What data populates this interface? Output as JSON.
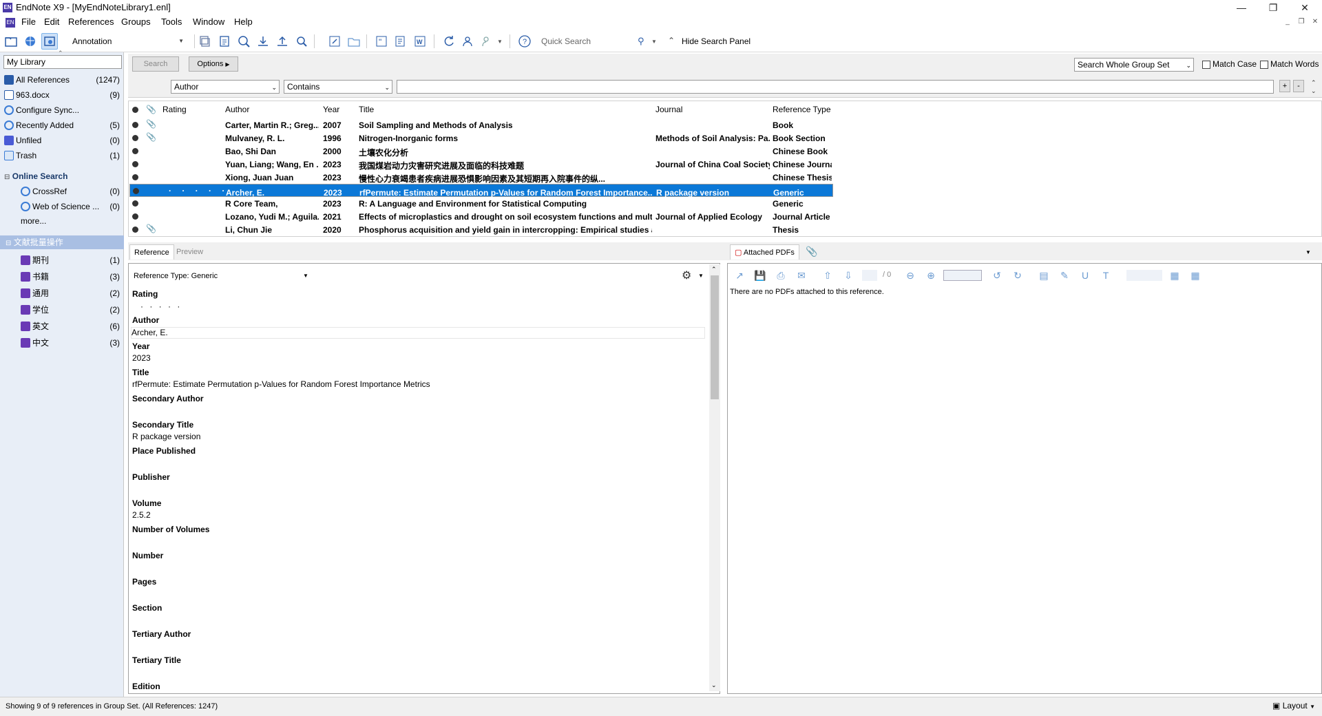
{
  "window": {
    "title": "EndNote X9 - [MyEndNoteLibrary1.enl]"
  },
  "menu": [
    "File",
    "Edit",
    "References",
    "Groups",
    "Tools",
    "Window",
    "Help"
  ],
  "toolbar": {
    "style": "Annotation",
    "quick_search_placeholder": "Quick Search",
    "hide_search_panel": "Hide Search Panel"
  },
  "library_selector": "My Library",
  "groups": [
    {
      "label": "All References",
      "count": "(1247)"
    },
    {
      "label": "963.docx",
      "count": "(9)"
    },
    {
      "label": "Configure Sync...",
      "count": ""
    },
    {
      "label": "Recently Added",
      "count": "(5)"
    },
    {
      "label": "Unfiled",
      "count": "(0)"
    },
    {
      "label": "Trash",
      "count": "(1)"
    }
  ],
  "online_search": {
    "header": "Online Search",
    "items": [
      {
        "label": "CrossRef",
        "count": "(0)"
      },
      {
        "label": "Web of Science ...",
        "count": "(0)"
      }
    ],
    "more": "more..."
  },
  "group_set": {
    "header": "文献批量操作",
    "items": [
      {
        "label": "期刊",
        "count": "(1)"
      },
      {
        "label": "书籍",
        "count": "(3)"
      },
      {
        "label": "通用",
        "count": "(2)"
      },
      {
        "label": "学位",
        "count": "(2)"
      },
      {
        "label": "英文",
        "count": "(6)"
      },
      {
        "label": "中文",
        "count": "(3)"
      }
    ]
  },
  "search_panel": {
    "search_button": "Search",
    "options_button": "Options",
    "scope": "Search Whole Group Set",
    "match_case": "Match Case",
    "match_words": "Match Words",
    "field": "Author",
    "operator": "Contains",
    "value": ""
  },
  "columns": {
    "rating": "Rating",
    "author": "Author",
    "year": "Year",
    "title": "Title",
    "journal": "Journal",
    "type": "Reference Type"
  },
  "references": [
    {
      "author": "Carter, Martin R.; Greg...",
      "year": "2007",
      "title": "Soil Sampling and Methods of Analysis",
      "journal": "",
      "type": "Book",
      "attach": true,
      "selected": false
    },
    {
      "author": "Mulvaney, R. L.",
      "year": "1996",
      "title": "Nitrogen-Inorganic forms",
      "journal": "Methods of Soil Analysis: Pa...",
      "type": "Book Section",
      "attach": true,
      "selected": false
    },
    {
      "author": "Bao, Shi Dan",
      "year": "2000",
      "title": "土壤农化分析",
      "journal": "",
      "type": "Chinese Book",
      "attach": false,
      "selected": false
    },
    {
      "author": "Yuan, Liang; Wang, En ...",
      "year": "2023",
      "title": "我国煤岩动力灾害研究进展及面临的科技难题",
      "journal": "Journal of China Coal Society",
      "type": "Chinese Journal",
      "attach": false,
      "selected": false
    },
    {
      "author": "Xiong, Juan Juan",
      "year": "2023",
      "title": "慢性心力衰竭患者疾病进展恐惧影响因素及其短期再入院事件的纵...",
      "journal": "",
      "type": "Chinese Thesis",
      "attach": false,
      "selected": false
    },
    {
      "author": "Archer, E.",
      "year": "2023",
      "title": "rfPermute: Estimate Permutation p-Values for Random Forest Importance...",
      "journal": "R package version",
      "type": "Generic",
      "attach": false,
      "selected": true
    },
    {
      "author": "R Core Team,",
      "year": "2023",
      "title": "R: A Language and Environment for Statistical Computing",
      "journal": "",
      "type": "Generic",
      "attach": false,
      "selected": false
    },
    {
      "author": "Lozano, Yudi M.; Aguila...",
      "year": "2021",
      "title": "Effects of microplastics and drought on soil ecosystem functions and multi...",
      "journal": "Journal of Applied Ecology",
      "type": "Journal Article",
      "attach": false,
      "selected": false
    },
    {
      "author": "Li, Chun Jie",
      "year": "2020",
      "title": "Phosphorus acquisition and yield gain in intercropping: Empirical studies an...",
      "journal": "",
      "type": "Thesis",
      "attach": true,
      "selected": false
    }
  ],
  "tabs": {
    "reference": "Reference",
    "preview": "Preview",
    "attached_pdfs": "Attached PDFs"
  },
  "reference_type_label": "Reference Type:",
  "reference_type_value": "Generic",
  "rating_dots": "· · · · ·",
  "fields": [
    {
      "label": "Rating",
      "value": ""
    },
    {
      "label": "Author",
      "value": "Archer, E."
    },
    {
      "label": "Year",
      "value": "2023"
    },
    {
      "label": "Title",
      "value": "rfPermute: Estimate Permutation p-Values for Random Forest Importance Metrics"
    },
    {
      "label": "Secondary Author",
      "value": ""
    },
    {
      "label": "Secondary Title",
      "value": "R package version"
    },
    {
      "label": "Place Published",
      "value": ""
    },
    {
      "label": "Publisher",
      "value": ""
    },
    {
      "label": "Volume",
      "value": "2.5.2"
    },
    {
      "label": "Number of Volumes",
      "value": ""
    },
    {
      "label": "Number",
      "value": ""
    },
    {
      "label": "Pages",
      "value": ""
    },
    {
      "label": "Section",
      "value": ""
    },
    {
      "label": "Tertiary Author",
      "value": ""
    },
    {
      "label": "Tertiary Title",
      "value": ""
    },
    {
      "label": "Edition",
      "value": ""
    }
  ],
  "pdf": {
    "no_pdf_message": "There are no PDFs attached to this reference.",
    "page_total": "/ 0"
  },
  "status": {
    "text": "Showing 9 of 9 references in Group Set. (All References: 1247)",
    "layout": "Layout"
  }
}
